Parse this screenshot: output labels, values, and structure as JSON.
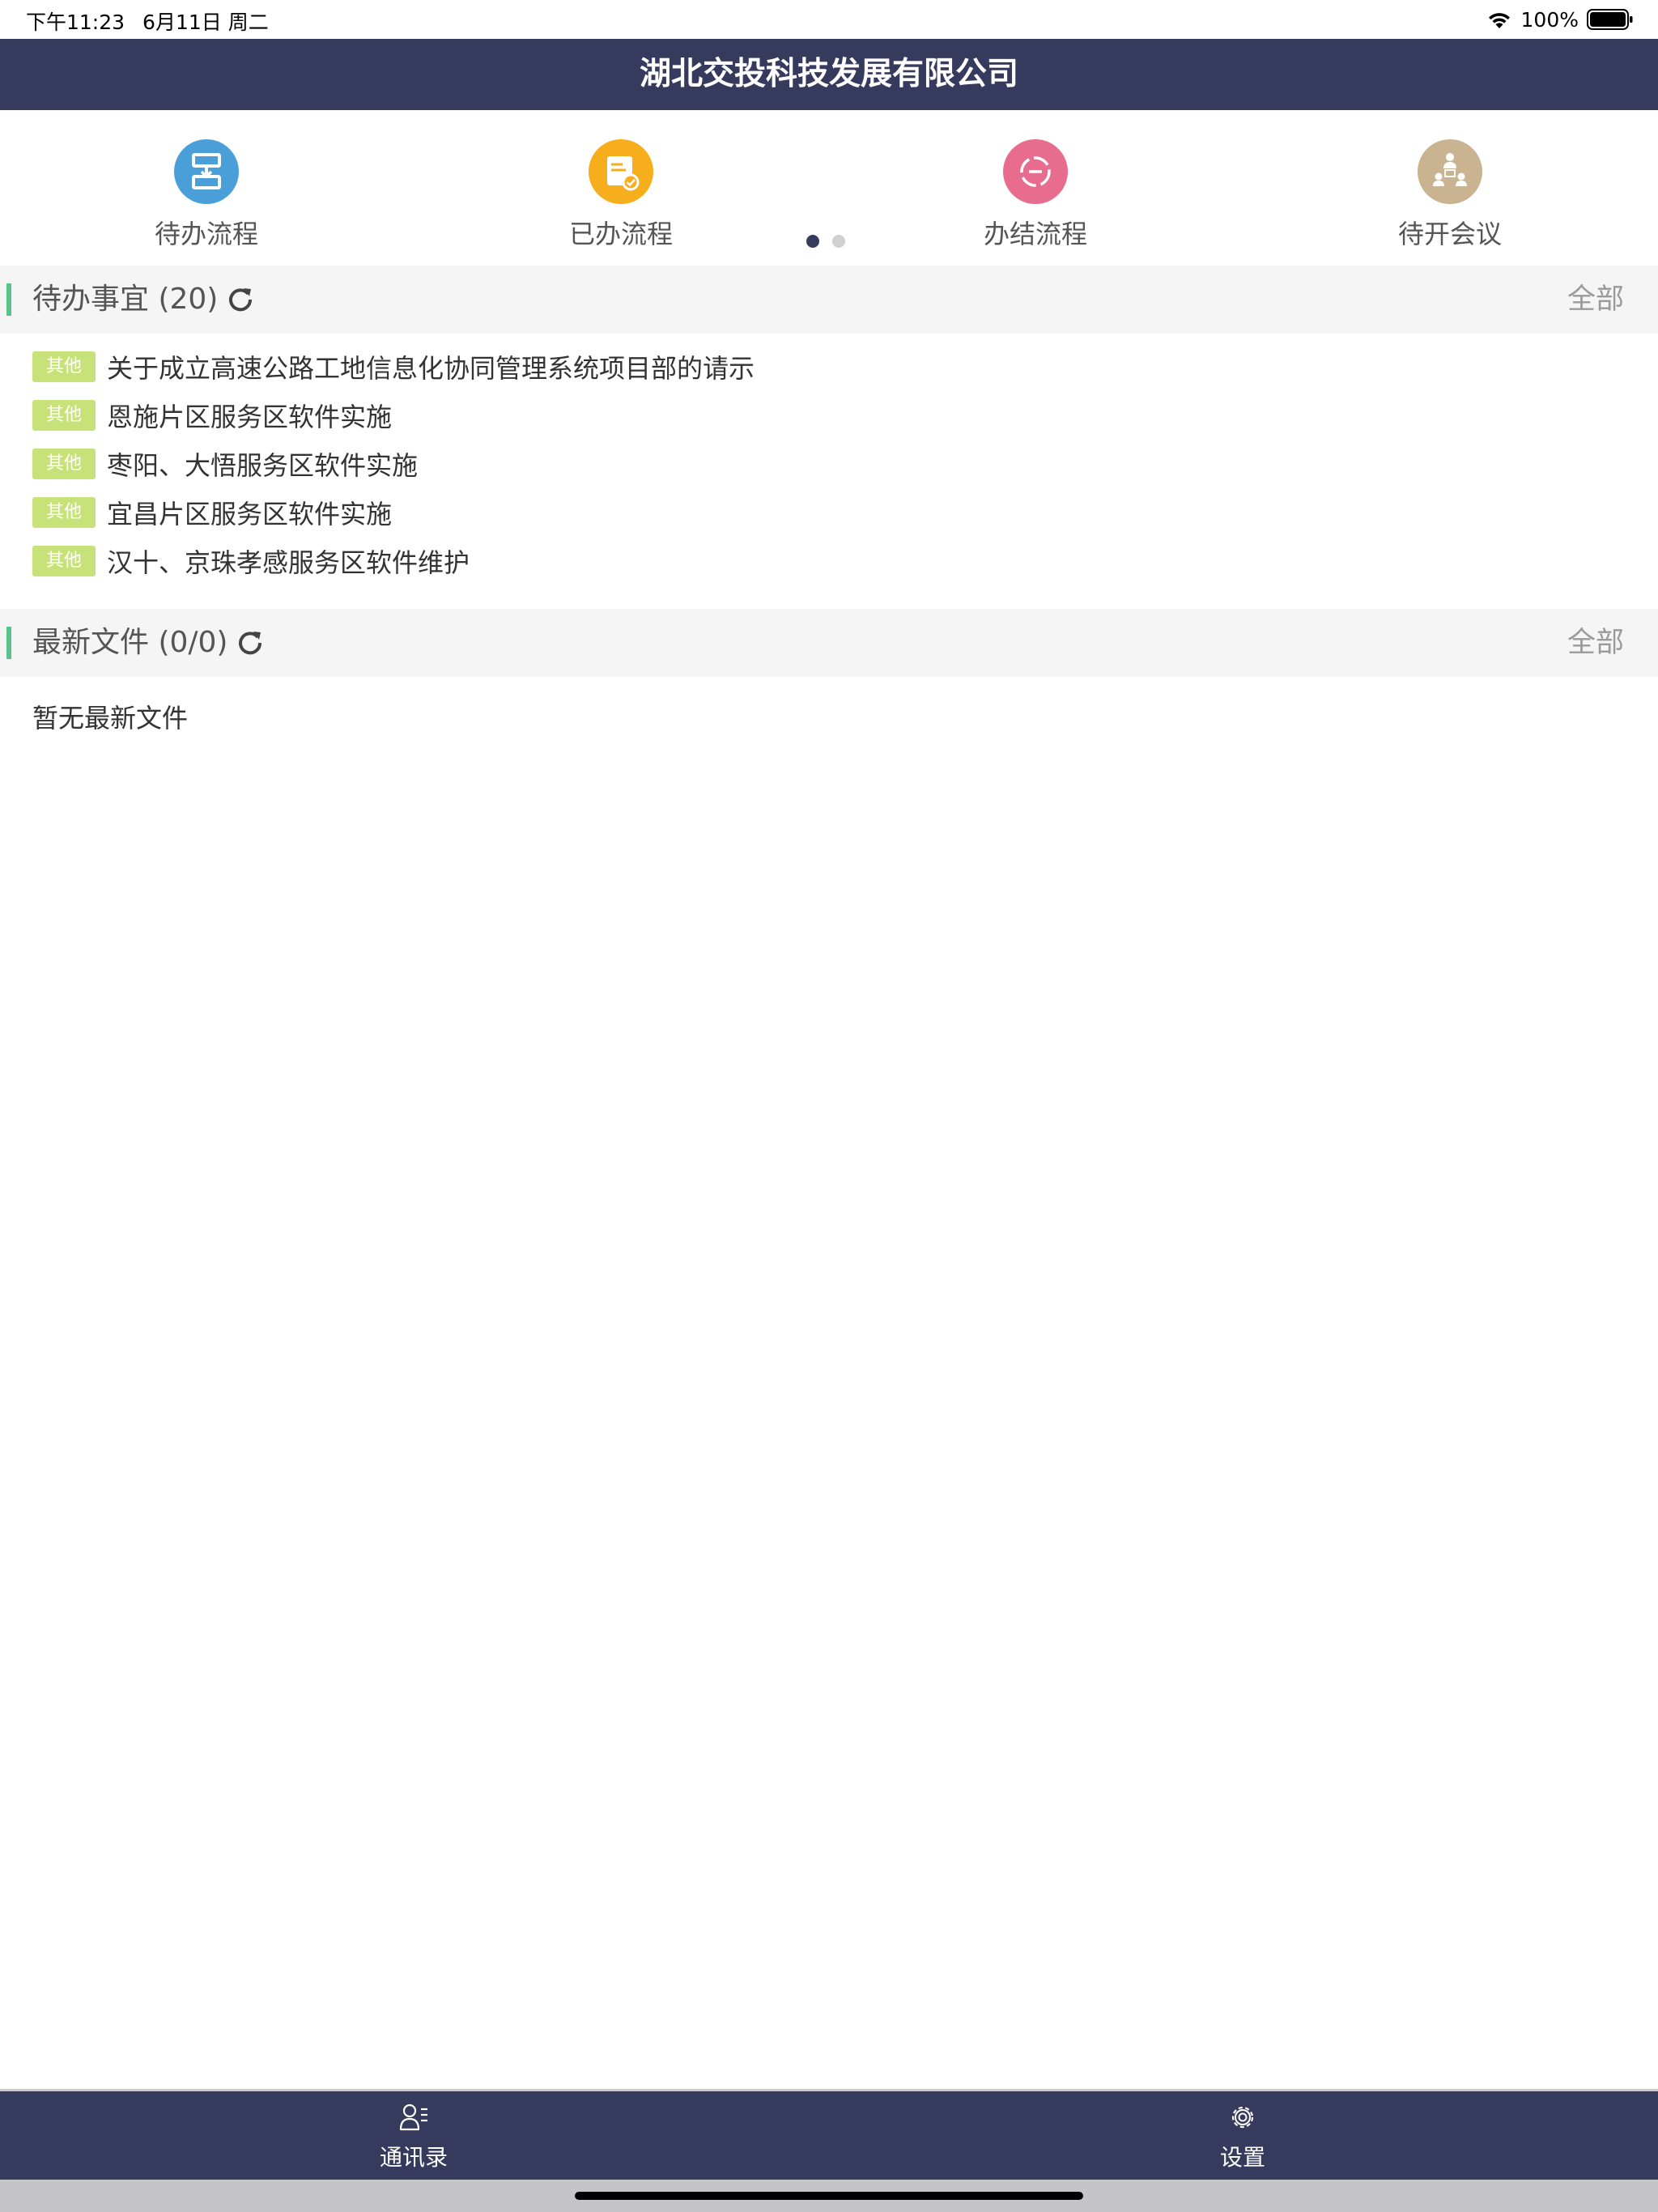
{
  "status_bar": {
    "time": "下午11:23",
    "date": "6月11日 周二",
    "battery": "100%"
  },
  "header": {
    "title": "湖北交投科技发展有限公司",
    "background": "#363b5e"
  },
  "quick_nav": {
    "items": [
      {
        "label": "待办流程",
        "icon": "flow-pending-icon",
        "color": "#4a9fd8"
      },
      {
        "label": "已办流程",
        "icon": "flow-done-icon",
        "color": "#f6ae1c"
      },
      {
        "label": "办结流程",
        "icon": "flow-closed-icon",
        "color": "#e86c8e"
      },
      {
        "label": "待开会议",
        "icon": "meeting-icon",
        "color": "#c9b391"
      }
    ],
    "pages": 2,
    "current_page": 1
  },
  "todo_section": {
    "title": "待办事宜 (20)",
    "all_label": "全部",
    "items": [
      {
        "tag": "其他",
        "text": "关于成立高速公路工地信息化协同管理系统项目部的请示"
      },
      {
        "tag": "其他",
        "text": "恩施片区服务区软件实施"
      },
      {
        "tag": "其他",
        "text": "枣阳、大悟服务区软件实施"
      },
      {
        "tag": "其他",
        "text": "宜昌片区服务区软件实施"
      },
      {
        "tag": "其他",
        "text": "汉十、京珠孝感服务区软件维护"
      }
    ]
  },
  "files_section": {
    "title": "最新文件 (0/0)",
    "all_label": "全部",
    "empty_text": "暂无最新文件"
  },
  "tab_bar": {
    "items": [
      {
        "label": "通讯录",
        "icon": "contacts-icon"
      },
      {
        "label": "设置",
        "icon": "gear-icon"
      }
    ]
  },
  "colors": {
    "accent_green": "#5ac28a",
    "tag_green": "#c8e27a",
    "nav_dark": "#363b5e"
  }
}
